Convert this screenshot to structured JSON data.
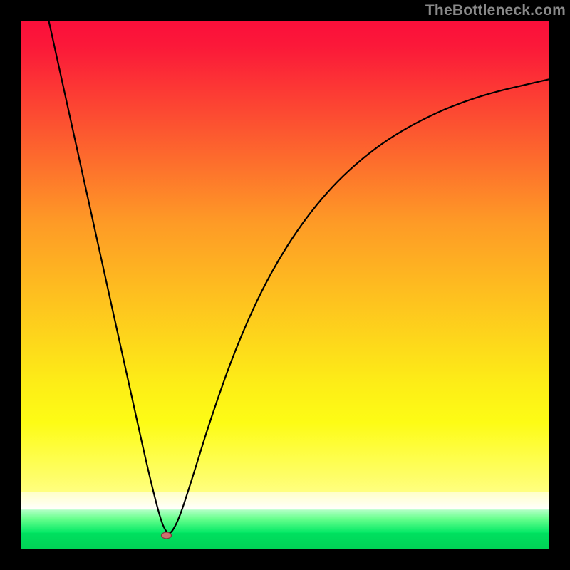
{
  "watermark": "TheBottleneck.com",
  "colors": {
    "curve": "#000000",
    "frame": "#000000",
    "marker_fill": "#cf6f6f",
    "marker_stroke": "#7e3d3d"
  },
  "chart_data": {
    "type": "line",
    "title": "",
    "xlabel": "",
    "ylabel": "",
    "xlim": [
      0,
      100
    ],
    "ylim": [
      0,
      100
    ],
    "gradient_bands": [
      {
        "y0": 0.0,
        "y1": 0.761,
        "stops": [
          {
            "offset": 0.0,
            "color": "#fb0f3a"
          },
          {
            "offset": 0.06,
            "color": "#fb1839"
          },
          {
            "offset": 0.5,
            "color": "#fe9a26"
          },
          {
            "offset": 0.9,
            "color": "#fded17"
          },
          {
            "offset": 1.0,
            "color": "#fdfc15"
          }
        ]
      },
      {
        "y0": 0.761,
        "y1": 0.893,
        "stops": [
          {
            "offset": 0.0,
            "color": "#fdfc15"
          },
          {
            "offset": 1.0,
            "color": "#ffff80"
          }
        ]
      },
      {
        "y0": 0.893,
        "y1": 0.926,
        "stops": [
          {
            "offset": 0.0,
            "color": "#ffffc8"
          },
          {
            "offset": 1.0,
            "color": "#ffffff"
          }
        ]
      },
      {
        "y0": 0.926,
        "y1": 0.97,
        "stops": [
          {
            "offset": 0.0,
            "color": "#b4ffc7"
          },
          {
            "offset": 0.4,
            "color": "#66ff8c"
          },
          {
            "offset": 1.0,
            "color": "#00e864"
          }
        ]
      },
      {
        "y0": 0.97,
        "y1": 1.0,
        "stops": [
          {
            "offset": 0.0,
            "color": "#00e05f"
          },
          {
            "offset": 1.0,
            "color": "#00d356"
          }
        ]
      }
    ],
    "marker": {
      "x": 27.5,
      "y": 2.5
    },
    "series": [
      {
        "name": "curve",
        "points": [
          {
            "x": 5.0,
            "y": 101.0
          },
          {
            "x": 12.5,
            "y": 67.0
          },
          {
            "x": 20.0,
            "y": 33.0
          },
          {
            "x": 25.0,
            "y": 10.5
          },
          {
            "x": 27.5,
            "y": 2.0
          },
          {
            "x": 29.5,
            "y": 4.5
          },
          {
            "x": 32.0,
            "y": 12.0
          },
          {
            "x": 36.0,
            "y": 25.0
          },
          {
            "x": 41.0,
            "y": 39.0
          },
          {
            "x": 47.0,
            "y": 52.0
          },
          {
            "x": 54.0,
            "y": 63.0
          },
          {
            "x": 62.0,
            "y": 72.0
          },
          {
            "x": 72.0,
            "y": 79.5
          },
          {
            "x": 85.0,
            "y": 85.5
          },
          {
            "x": 100.0,
            "y": 89.0
          }
        ]
      }
    ]
  }
}
